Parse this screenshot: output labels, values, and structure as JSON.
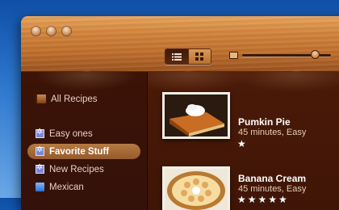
{
  "sidebar": {
    "items": [
      {
        "label": "All Recipes",
        "icon": "book-icon"
      },
      {
        "label": "Easy ones",
        "icon": "smart-folder-icon"
      },
      {
        "label": "Favorite Stuff",
        "icon": "smart-folder-icon",
        "selected": true
      },
      {
        "label": "New Recipes",
        "icon": "smart-folder-icon"
      },
      {
        "label": "Mexican",
        "icon": "folder-icon"
      }
    ]
  },
  "toolbar": {
    "view_modes": [
      "list-view-icon",
      "grid-view-icon"
    ],
    "active_view": "list",
    "zoom_slider_value": 0.82
  },
  "recipes": [
    {
      "name": "Pumkin Pie",
      "meta": "45 minutes, Easy",
      "rating": 1,
      "stars": "★"
    },
    {
      "name": "Banana Cream",
      "meta": "45 minutes, Easy",
      "rating": 5,
      "stars": "★★★★★"
    }
  ],
  "colors": {
    "desktop": "#2f79cf",
    "toolbar_wood": "#c97a35",
    "sidebar_bg": "#3c1306",
    "main_bg": "#4b1a08",
    "selection": "#a96c38"
  }
}
